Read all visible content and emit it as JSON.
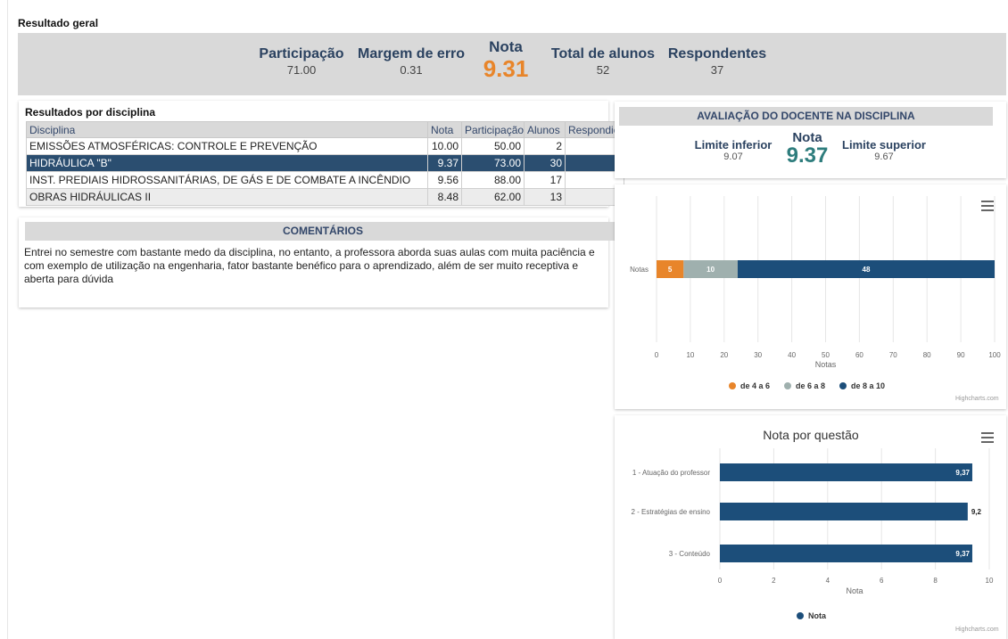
{
  "page": {
    "title": "Resultado geral"
  },
  "summary": {
    "participacao": {
      "label": "Participação",
      "value": "71.00"
    },
    "margem": {
      "label": "Margem de erro",
      "value": "0.31"
    },
    "nota": {
      "label": "Nota",
      "value": "9.31"
    },
    "total_alunos": {
      "label": "Total de alunos",
      "value": "52"
    },
    "respondentes": {
      "label": "Respondentes",
      "value": "37"
    }
  },
  "disciplinas": {
    "title": "Resultados por disciplina",
    "columns": [
      "Disciplina",
      "Nota",
      "Participação",
      "Alunos",
      "Respondic"
    ],
    "rows": [
      [
        "EMISSÕES ATMOSFÉRICAS: CONTROLE E PREVENÇÃO",
        "10.00",
        "50.00",
        "2",
        ""
      ],
      [
        "HIDRÁULICA \"B\"",
        "9.37",
        "73.00",
        "30",
        ""
      ],
      [
        "INST. PREDIAIS HIDROSSANITÁRIAS, DE GÁS E DE COMBATE A INCÊNDIO",
        "9.56",
        "88.00",
        "17",
        ""
      ],
      [
        "OBRAS HIDRÁULICAS II",
        "8.48",
        "62.00",
        "13",
        ""
      ]
    ],
    "selected_row": 1
  },
  "comments": {
    "header": "COMENTÁRIOS",
    "text": "Entrei no semestre com bastante medo da disciplina, no entanto, a professora aborda suas aulas com muita paciência e com exemplo de utilização na engenharia, fator bastante benéfico para o aprendizado, além de ser muito receptiva e aberta para dúvida"
  },
  "docente": {
    "header": "AVALIAÇÃO DO DOCENTE NA DISCIPLINA",
    "limite_inferior": {
      "label": "Limite inferior",
      "value": "9.07"
    },
    "nota": {
      "label": "Nota",
      "value": "9.37"
    },
    "limite_superior": {
      "label": "Limite superior",
      "value": "9.67"
    }
  },
  "colors": {
    "orange": "#e8852a",
    "gray": "#9fb0ae",
    "navy": "#1c4e7a",
    "teal": "#2e7d7d",
    "header_text": "#33476a"
  },
  "icons": {
    "chart_menu": "hamburger-menu-icon"
  },
  "chart_data": [
    {
      "type": "bar",
      "stacked": true,
      "orientation": "horizontal",
      "categories": [
        "Notas"
      ],
      "series": [
        {
          "name": "de 4 a 6",
          "values": [
            8
          ],
          "data_label": "5",
          "color": "#e8852a"
        },
        {
          "name": "de 6 a 8",
          "values": [
            16
          ],
          "data_label": "10",
          "color": "#9fb0ae"
        },
        {
          "name": "de 8 a 10",
          "values": [
            76
          ],
          "data_label": "48",
          "color": "#1c4e7a"
        }
      ],
      "xlabel": "Notas",
      "xlim": [
        0,
        100
      ],
      "xticks": [
        0,
        10,
        20,
        30,
        40,
        50,
        60,
        70,
        80,
        90,
        100
      ],
      "grid": true,
      "legend": "bottom-center",
      "credit": "Highcharts.com"
    },
    {
      "type": "bar",
      "orientation": "horizontal",
      "title": "Nota por questão",
      "categories": [
        "1 - Atuação do professor",
        "2 - Estratégias de ensino",
        "3 - Conteúdo"
      ],
      "series": [
        {
          "name": "Nota",
          "values": [
            9.37,
            9.2,
            9.37
          ],
          "labels": [
            "9,37",
            "9,2",
            "9,37"
          ],
          "color": "#1c4e7a"
        }
      ],
      "xlabel": "Nota",
      "xlim": [
        0,
        10
      ],
      "xticks": [
        0,
        2,
        4,
        6,
        8,
        10
      ],
      "grid": true,
      "legend": "bottom-center",
      "credit": "Highcharts.com"
    }
  ]
}
